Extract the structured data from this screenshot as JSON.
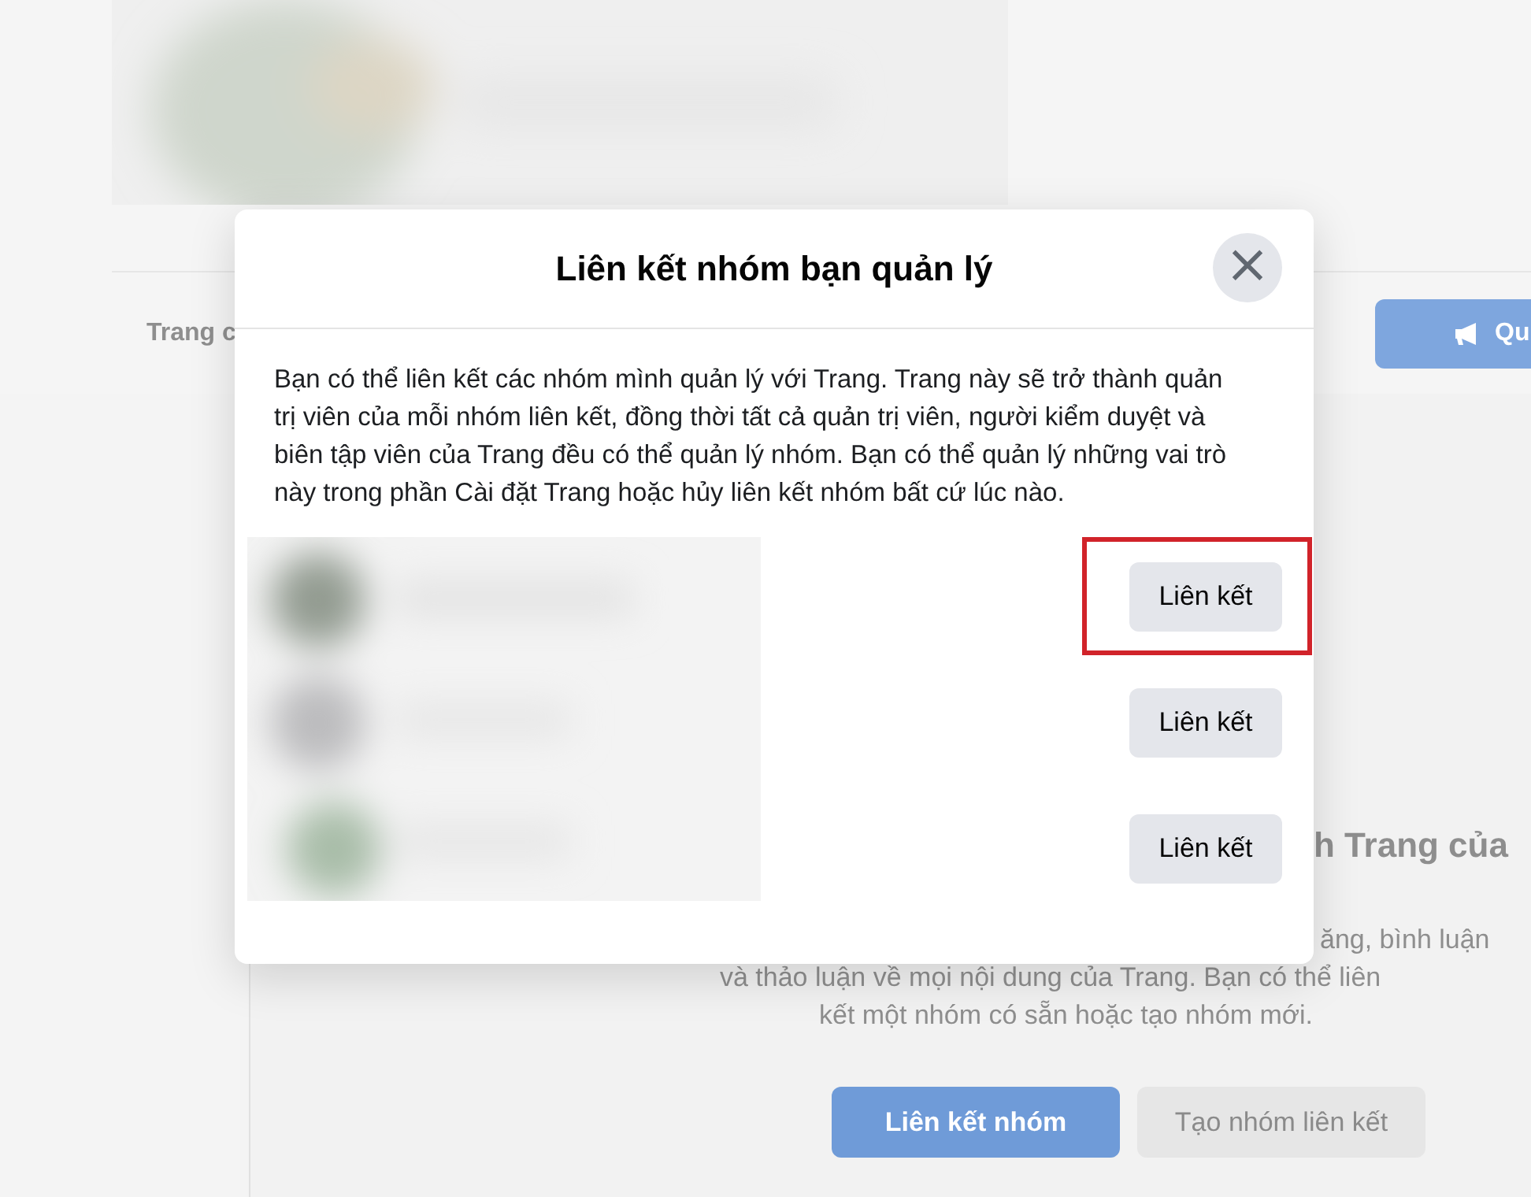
{
  "page": {
    "nav_tab": "Trang c",
    "promote_button": "Qu",
    "section_heading": "h Trang của",
    "section_text_lines": [
      "ăng, bình luận",
      "và thảo luận về mọi nội dung của Trang. Bạn có thể liên",
      "kết một nhóm có sẵn hoặc tạo nhóm mới."
    ],
    "buttons": [
      {
        "label": "Liên kết nhóm",
        "kind": "primary"
      },
      {
        "label": "Tạo nhóm liên kết",
        "kind": "secondary"
      }
    ]
  },
  "dialog": {
    "title": "Liên kết nhóm bạn quản lý",
    "close": "×",
    "description": "Bạn có thể liên kết các nhóm mình quản lý với Trang. Trang này sẽ trở thành quản trị viên của mỗi nhóm liên kết, đồng thời tất cả quản trị viên, người kiểm duyệt và biên tập viên của Trang đều có thể quản lý nhóm. Bạn có thể quản lý những vai trò này trong phần Cài đặt Trang hoặc hủy liên kết nhóm bất cứ lúc nào.",
    "groups": [
      {
        "button": "Liên kết",
        "highlighted": true
      },
      {
        "button": "Liên kết",
        "highlighted": false
      },
      {
        "button": "Liên kết",
        "highlighted": false
      }
    ]
  }
}
